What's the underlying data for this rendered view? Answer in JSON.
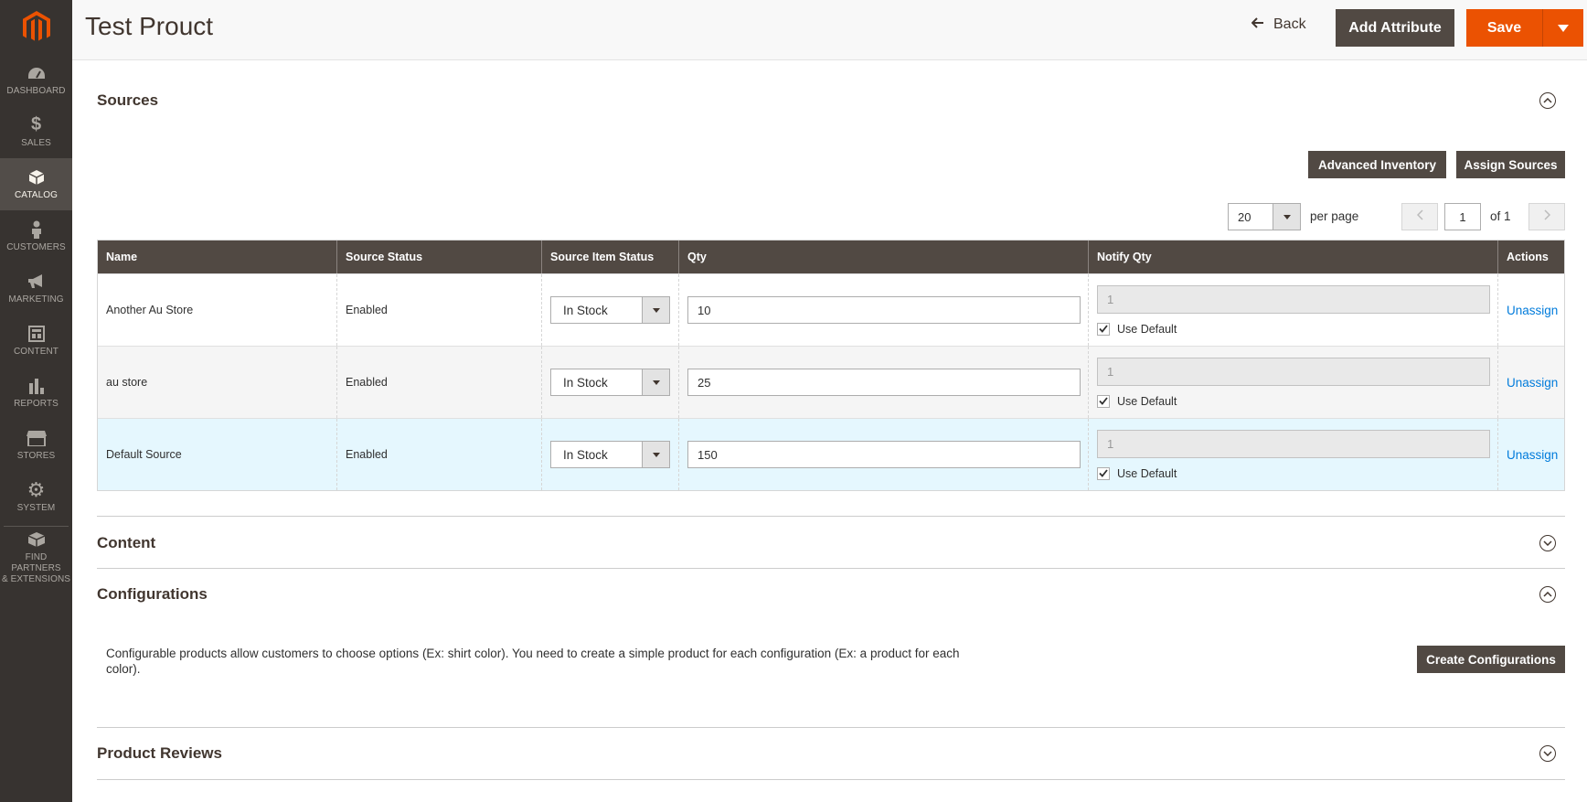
{
  "sidebar": {
    "items": [
      {
        "label": "Dashboard",
        "icon": "dashboard-icon"
      },
      {
        "label": "Sales",
        "icon": "dollar-icon"
      },
      {
        "label": "Catalog",
        "icon": "box-icon"
      },
      {
        "label": "Customers",
        "icon": "person-icon"
      },
      {
        "label": "Marketing",
        "icon": "megaphone-icon"
      },
      {
        "label": "Content",
        "icon": "layout-icon"
      },
      {
        "label": "Reports",
        "icon": "bar-chart-icon"
      },
      {
        "label": "Stores",
        "icon": "storefront-icon"
      },
      {
        "label": "System",
        "icon": "gear-icon"
      }
    ],
    "partners_line1": "Find Partners",
    "partners_line2": "& Extensions"
  },
  "header": {
    "title": "Test Prouct",
    "back_label": "Back",
    "add_attribute_label": "Add Attribute",
    "save_label": "Save"
  },
  "sources": {
    "title": "Sources",
    "advanced_inventory_label": "Advanced Inventory",
    "assign_sources_label": "Assign Sources",
    "per_page_value": "20",
    "per_page_label": "per page",
    "page_value": "1",
    "page_of": "of 1",
    "columns": [
      "Name",
      "Source Status",
      "Source Item Status",
      "Qty",
      "Notify Qty",
      "Actions"
    ],
    "rows": [
      {
        "name": "Another Au Store",
        "status": "Enabled",
        "item_status": "In Stock",
        "qty": "10",
        "notify_qty": "1",
        "use_default": "Use Default",
        "action": "Unassign"
      },
      {
        "name": "au store",
        "status": "Enabled",
        "item_status": "In Stock",
        "qty": "25",
        "notify_qty": "1",
        "use_default": "Use Default",
        "action": "Unassign"
      },
      {
        "name": "Default Source",
        "status": "Enabled",
        "item_status": "In Stock",
        "qty": "150",
        "notify_qty": "1",
        "use_default": "Use Default",
        "action": "Unassign"
      }
    ]
  },
  "content_section": {
    "title": "Content"
  },
  "configurations": {
    "title": "Configurations",
    "description": "Configurable products allow customers to choose options (Ex: shirt color). You need to create a simple product for each configuration (Ex: a product for each color).",
    "create_label": "Create Configurations"
  },
  "product_reviews": {
    "title": "Product Reviews"
  },
  "colors": {
    "accent": "#eb5202",
    "dark": "#514943",
    "sidebar": "#373330",
    "link": "#007bdb"
  }
}
